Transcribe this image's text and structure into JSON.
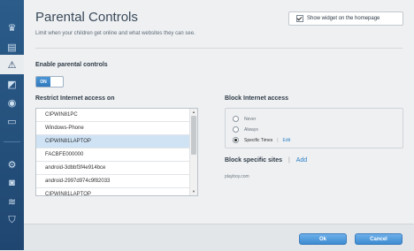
{
  "page": {
    "title": "Parental Controls",
    "subtitle": "Limit when your children get online and what websites they can see."
  },
  "widget": {
    "label": "Show widget on the homepage",
    "checked": true
  },
  "parental": {
    "heading": "Enable parental controls",
    "toggle_label": "ON"
  },
  "restrict": {
    "heading": "Restrict Internet access on",
    "devices": [
      "CIPWIN81PC",
      "Windows-Phone",
      "CIPWIN81LAPTOP",
      "FACBFE000000",
      "android-3dbbf3f4e914bce",
      "android-2997d974c9f82033",
      "CIPWIN81LAPTOP"
    ],
    "selected_index": 2
  },
  "block": {
    "heading": "Block Internet access",
    "options": [
      "Never",
      "Always",
      "Specific Times"
    ],
    "selected": "Specific Times",
    "edit_label": "Edit"
  },
  "sites": {
    "heading": "Block specific sites",
    "add_label": "Add",
    "items": [
      "playboy.com"
    ]
  },
  "buttons": {
    "ok": "Ok",
    "cancel": "Cancel"
  },
  "sidebar": {
    "icons": [
      "crown-icon",
      "device-list-icon",
      "warning-icon",
      "apps-icon",
      "media-icon",
      "speed-icon",
      "router-icon",
      "camera-icon",
      "wifi-icon",
      "security-shield-icon"
    ],
    "active": "warning-icon"
  }
}
